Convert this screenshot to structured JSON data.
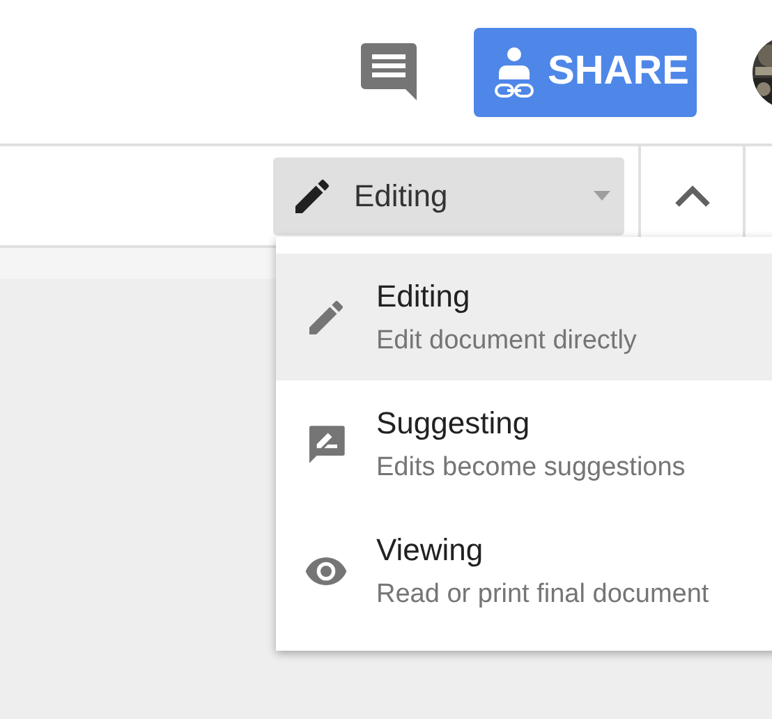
{
  "header": {
    "share_button": {
      "label": "SHARE"
    }
  },
  "toolbar": {
    "mode_button": {
      "label": "Editing"
    }
  },
  "mode_menu": [
    {
      "kind": "editing",
      "title": "Editing",
      "subtitle": "Edit document directly",
      "selected": true
    },
    {
      "kind": "suggesting",
      "title": "Suggesting",
      "subtitle": "Edits become suggestions",
      "selected": false
    },
    {
      "kind": "viewing",
      "title": "Viewing",
      "subtitle": "Read or print final document",
      "selected": false
    }
  ]
}
